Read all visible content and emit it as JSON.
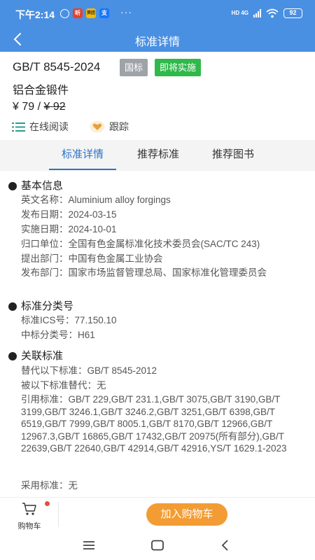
{
  "status": {
    "time": "下午2:14",
    "app_icons": [
      "alarm-icon",
      "听",
      "美团",
      "支"
    ],
    "more": "···",
    "network": "HD 4G",
    "battery": "92"
  },
  "nav": {
    "title": "标准详情"
  },
  "standard": {
    "number": "GB/T 8545-2024",
    "badge_type": "国标",
    "badge_status": "即将实施",
    "name": "铝合金锻件",
    "price_prefix": "¥ 79 / ",
    "price_original": "¥ 92"
  },
  "actions": {
    "read_label": "在线阅读",
    "follow_label": "跟踪"
  },
  "tabs": [
    "标准详情",
    "推荐标准",
    "推荐图书"
  ],
  "sections": {
    "basic": {
      "title": "基本信息",
      "rows": [
        "英文名称：Aluminium alloy forgings",
        "发布日期：2024-03-15",
        "实施日期：2024-10-01",
        "归口单位：全国有色金属标准化技术委员会(SAC/TC 243)",
        "提出部门：中国有色金属工业协会",
        "发布部门：国家市场监督管理总局、国家标准化管理委员会"
      ]
    },
    "classification": {
      "title": "标准分类号",
      "rows": [
        "标准ICS号：77.150.10",
        "中标分类号：H61"
      ]
    },
    "related": {
      "title": "关联标准",
      "rows": [
        "替代以下标准：GB/T 8545-2012",
        "被以下标准替代：无",
        "引用标准：GB/T 229,GB/T 231.1,GB/T 3075,GB/T 3190,GB/T 3199,GB/T 3246.1,GB/T 3246.2,GB/T 3251,GB/T 6398,GB/T 6519,GB/T 7999,GB/T 8005.1,GB/T 8170,GB/T 12966,GB/T 12967.3,GB/T 16865,GB/T 17432,GB/T 20975(所有部分),GB/T 22639,GB/T 22640,GB/T 42914,GB/T 42916,YS/T 1629.1-2023",
        "采用标准：无"
      ]
    }
  },
  "bottom": {
    "cart_label": "购物车",
    "add_cart_label": "加入购物车"
  },
  "colors": {
    "primary": "#4a90e2",
    "active_tab": "#2a73c7",
    "orange": "#f39c34",
    "green": "#30b94b"
  }
}
